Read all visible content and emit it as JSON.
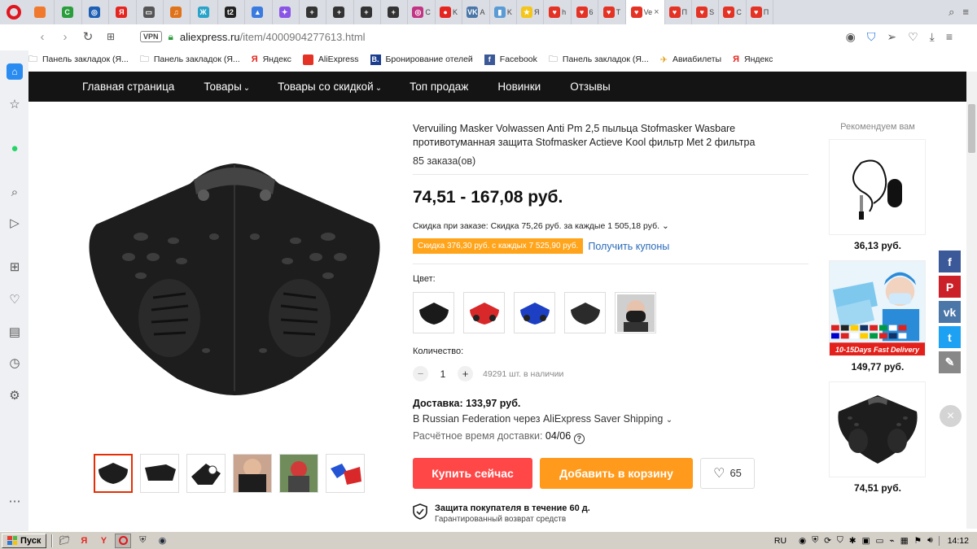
{
  "browser": {
    "active_tab": {
      "label": "Ve",
      "close": "×"
    },
    "tabs": [
      {
        "label": "",
        "color": "#f0792e",
        "glyph": ""
      },
      {
        "label": "",
        "color": "#2a9d3c",
        "glyph": "C"
      },
      {
        "label": "",
        "color": "#1e5fb3",
        "glyph": "◎"
      },
      {
        "label": "",
        "color": "#e52620",
        "glyph": "Я"
      },
      {
        "label": "",
        "color": "#555555",
        "glyph": "▭"
      },
      {
        "label": "",
        "color": "#e0731a",
        "glyph": "♫"
      },
      {
        "label": "",
        "color": "#2aa3c9",
        "glyph": "Ж"
      },
      {
        "label": "",
        "color": "#222222",
        "glyph": "t2"
      },
      {
        "label": "",
        "color": "#3b7be0",
        "glyph": "▲"
      },
      {
        "label": "",
        "color": "#8a55e6",
        "glyph": "✦"
      },
      {
        "label": "",
        "color": "#333333",
        "glyph": "+"
      },
      {
        "label": "",
        "color": "#333333",
        "glyph": "+"
      },
      {
        "label": "",
        "color": "#333333",
        "glyph": "+"
      },
      {
        "label": "",
        "color": "#333333",
        "glyph": "+"
      },
      {
        "label": "C",
        "color": "#c13584",
        "glyph": "◎"
      },
      {
        "label": "K",
        "color": "#e52620",
        "glyph": "●"
      },
      {
        "label": "A",
        "color": "#4a76a8",
        "glyph": "VK"
      },
      {
        "label": "K",
        "color": "#5b9bd5",
        "glyph": "▮"
      },
      {
        "label": "Я",
        "color": "#f5c518",
        "glyph": "★"
      },
      {
        "label": "h",
        "color": "#e43225",
        "glyph": "♥"
      },
      {
        "label": "6",
        "color": "#e43225",
        "glyph": "♥"
      },
      {
        "label": "T",
        "color": "#e43225",
        "glyph": "♥"
      }
    ],
    "tabs_after": [
      {
        "label": "П",
        "color": "#e43225",
        "glyph": "♥"
      },
      {
        "label": "S",
        "color": "#e43225",
        "glyph": "♥"
      },
      {
        "label": "C",
        "color": "#e43225",
        "glyph": "♥"
      },
      {
        "label": "П",
        "color": "#e43225",
        "glyph": "♥"
      }
    ],
    "tab_actions": {
      "search": "⌕",
      "menu": "≡"
    },
    "url_host": "aliexpress.ru",
    "url_path": "/item/4000904277613.html",
    "vpn_label": "VPN"
  },
  "bookmarks": [
    {
      "label": "Панель закладок (Я...",
      "icon": "folder-icon"
    },
    {
      "label": "Панель закладок (Я...",
      "icon": "folder-icon"
    },
    {
      "label": "Яндекс",
      "icon": "yandex-icon"
    },
    {
      "label": "AliExpress",
      "icon": "aliexpress-icon"
    },
    {
      "label": "Бронирование отелей",
      "icon": "booking-icon"
    },
    {
      "label": "Facebook",
      "icon": "facebook-icon"
    },
    {
      "label": "Панель закладок (Я...",
      "icon": "folder-icon"
    },
    {
      "label": "Авиабилеты",
      "icon": "plane-icon"
    },
    {
      "label": "Яндекс",
      "icon": "yandex-icon"
    }
  ],
  "topnav": [
    {
      "label": "Главная страница",
      "caret": ""
    },
    {
      "label": "Товары",
      "caret": "⌄"
    },
    {
      "label": "Товары со скидкой",
      "caret": "⌄"
    },
    {
      "label": "Топ продаж",
      "caret": ""
    },
    {
      "label": "Новинки",
      "caret": ""
    },
    {
      "label": "Отзывы",
      "caret": ""
    }
  ],
  "product": {
    "title": "Vervuiling Masker Volwassen Anti Pm 2,5 пыльца Stofmasker Wasbare противотуманная защита Stofmasker Actieve Kool фильтр Met 2 фильтра",
    "orders": "85 заказа(ов)",
    "price": "74,51 - 167,08 руб.",
    "discount_note": "Скидка при заказе: Скидка 75,26 руб. за каждые 1 505,18 руб.",
    "coupon": "Скидка 376,30 руб. с каждых 7 525,90 руб.",
    "get_coupons": "Получить купоны",
    "color_label": "Цвет:",
    "colors": [
      {
        "name": "black",
        "hex": "#1a1a1a"
      },
      {
        "name": "red",
        "hex": "#d8282a"
      },
      {
        "name": "blue",
        "hex": "#1d3fc4"
      },
      {
        "name": "dark",
        "hex": "#2b2b2b"
      },
      {
        "name": "photo",
        "hex": "#222222"
      }
    ],
    "qty_label": "Количество:",
    "qty": "1",
    "stock": "49291 шт. в наличии",
    "shipping": "Доставка: 133,97 руб.",
    "ship_via": "В Russian Federation через AliExpress Saver Shipping",
    "eta_label": "Расчётное время доставки:",
    "eta_date": "04/06",
    "buy": "Купить сейчас",
    "cart": "Добавить в корзину",
    "wishes": "65",
    "protect_title": "Защита покупателя в течение 60 д.",
    "protect_sub": "Гарантированный возврат средств"
  },
  "recommend": {
    "title": "Рекомендуем вам",
    "items": [
      {
        "price": "36,13 руб."
      },
      {
        "price": "149,77 руб.",
        "badge": "10-15Days Fast Delivery"
      },
      {
        "price": "74,51 руб."
      }
    ]
  },
  "share": [
    {
      "name": "facebook",
      "glyph": "f",
      "color": "#3b5998"
    },
    {
      "name": "pinterest",
      "glyph": "P",
      "color": "#cb2027"
    },
    {
      "name": "vk",
      "glyph": "vk",
      "color": "#4a76a8"
    },
    {
      "name": "twitter",
      "glyph": "t",
      "color": "#1da1f2"
    },
    {
      "name": "edit",
      "glyph": "✎",
      "color": "#888888"
    }
  ],
  "taskbar": {
    "start": "Пуск",
    "lang": "RU",
    "clock": "14:12"
  }
}
